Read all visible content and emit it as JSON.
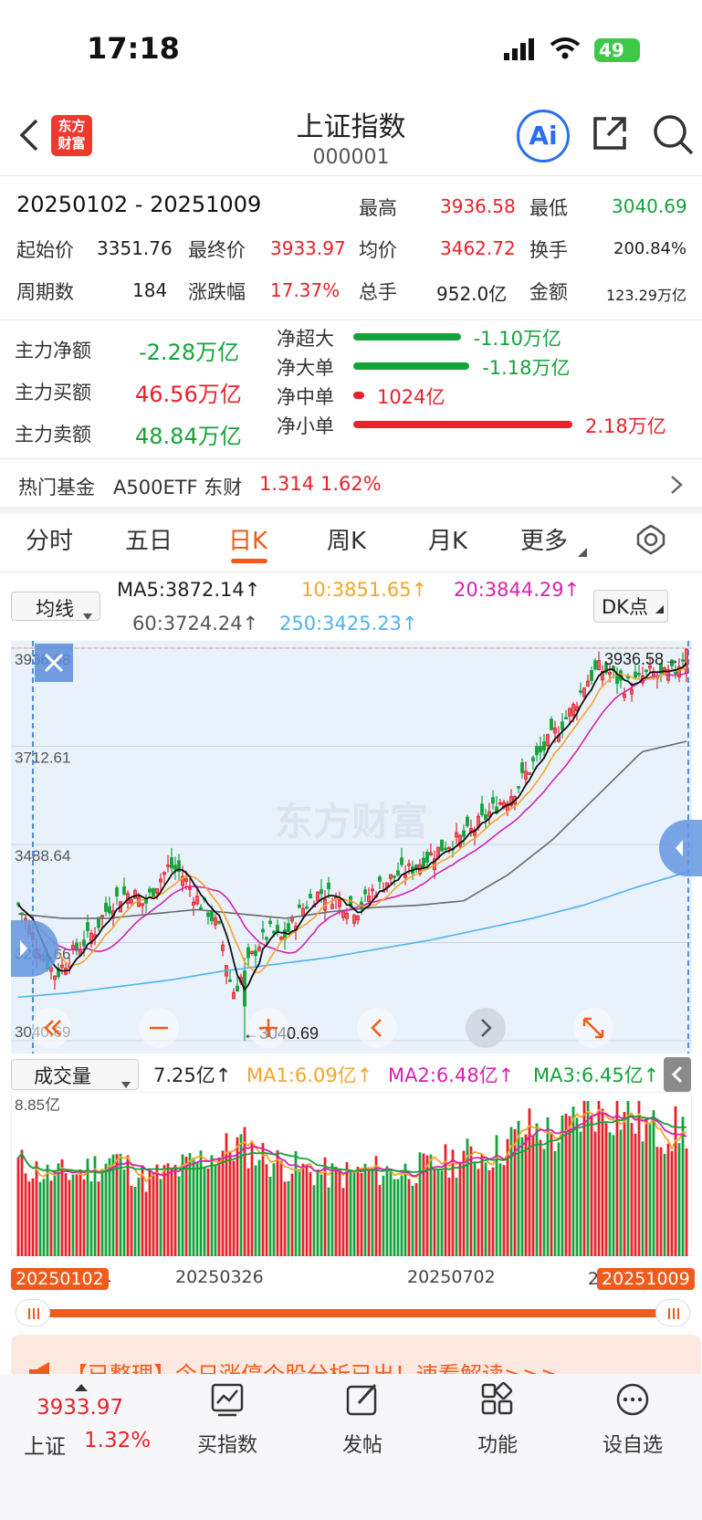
{
  "status_bar": {
    "time": "17:18",
    "battery": "49"
  },
  "header": {
    "title": "上证指数",
    "code": "000001",
    "logo_text_line1": "东方",
    "logo_text_line2": "财富",
    "ai_label": "Ai"
  },
  "summary": {
    "date_range": "20250102 - 20251009",
    "high_label": "最高",
    "high": "3936.58",
    "low_label": "最低",
    "low": "3040.69",
    "open_label": "起始价",
    "open": "3351.76",
    "close_label": "最终价",
    "close": "3933.97",
    "avg_label": "均价",
    "avg": "3462.72",
    "turnover_label": "换手",
    "turnover": "200.84%",
    "periods_label": "周期数",
    "periods": "184",
    "change_label": "涨跌幅",
    "change": "17.37%",
    "volume_label": "总手",
    "volume": "952.0亿",
    "amount_label": "金额",
    "amount": "123.29万亿"
  },
  "capital_flow": {
    "net_label": "主力净额",
    "net": "-2.28万亿",
    "buy_label": "主力买额",
    "buy": "46.56万亿",
    "sell_label": "主力卖额",
    "sell": "48.84万亿",
    "rows": [
      {
        "label": "净超大",
        "value": "-1.10万亿",
        "color": "#14a33a",
        "level": 0.49
      },
      {
        "label": "净大单",
        "value": "-1.18万亿",
        "color": "#14a33a",
        "level": 0.53
      },
      {
        "label": "净中单",
        "value": "1024亿",
        "color": "#e8212a",
        "level": 0.05
      },
      {
        "label": "净小单",
        "value": "2.18万亿",
        "color": "#e8212a",
        "level": 1.0
      }
    ]
  },
  "hot_fund": {
    "label": "热门基金",
    "name": "A500ETF 东财",
    "price": "1.314",
    "pct": "1.62%"
  },
  "tabs": [
    "分时",
    "五日",
    "日K",
    "周K",
    "月K",
    "更多"
  ],
  "active_tab": "日K",
  "ma_bar": {
    "select": "均线",
    "ma5": "MA5:3872.14↑",
    "ma10": "10:3851.65↑",
    "ma20": "20:3844.29↑",
    "ma60": "60:3724.24↑",
    "ma250": "250:3425.23↑",
    "dk": "DK点"
  },
  "price_axis": [
    "3936.58",
    "3712.61",
    "3488.64",
    "3264.66",
    "3040.69"
  ],
  "chart_high_label": "3936.58→",
  "chart_low_label": "←3040.69",
  "watermark": "东方财富",
  "volume_bar": {
    "select": "成交量",
    "vol": "7.25亿↑",
    "ma1": "MA1:6.09亿↑",
    "ma2": "MA2:6.48亿↑",
    "ma3": "MA3:6.45亿↑",
    "axis_max": "8.85亿"
  },
  "date_axis": [
    "20250102",
    "4",
    "20250326",
    "20250702",
    "2",
    "20251009"
  ],
  "banner": {
    "text": "【已整理】今日涨停个股分析已出！速看解读>>>"
  },
  "bottom_nav": {
    "index_price": "3933.97",
    "index_name": "上证",
    "index_pct": "1.32%",
    "items": [
      "买指数",
      "发帖",
      "功能",
      "设自选"
    ]
  },
  "chart_data": {
    "type": "candlestick",
    "x_range": [
      "20250102",
      "20251009"
    ],
    "ylim": [
      3040.69,
      3936.58
    ],
    "yticks": [
      3936.58,
      3712.61,
      3488.64,
      3264.66,
      3040.69
    ],
    "x_tick_labels": [
      "20250102",
      "20250326",
      "20250702",
      "20251009"
    ],
    "close_trend": [
      3352,
      3290,
      3230,
      3190,
      3230,
      3260,
      3290,
      3340,
      3370,
      3380,
      3350,
      3400,
      3440,
      3420,
      3370,
      3340,
      3290,
      3150,
      3200,
      3260,
      3290,
      3270,
      3320,
      3360,
      3380,
      3370,
      3350,
      3340,
      3380,
      3400,
      3420,
      3430,
      3450,
      3470,
      3490,
      3500,
      3520,
      3550,
      3580,
      3600,
      3640,
      3680,
      3720,
      3760,
      3800,
      3860,
      3890,
      3880,
      3850,
      3860,
      3880,
      3870,
      3880,
      3934
    ],
    "ma250_trend": [
      3140,
      3150,
      3165,
      3180,
      3200,
      3215,
      3230,
      3250,
      3270,
      3295,
      3320,
      3350,
      3390,
      3425
    ],
    "ma60_trend": [
      3330,
      3320,
      3320,
      3330,
      3340,
      3330,
      3320,
      3335,
      3345,
      3350,
      3360,
      3420,
      3500,
      3600,
      3700,
      3724
    ],
    "volume_max": 8.85,
    "volume_trend": [
      5.3,
      4.6,
      4.8,
      5.6,
      4.4,
      4.9,
      5.7,
      6.4,
      5.4,
      4.9,
      4.6,
      4.9,
      4.8,
      5.1,
      5.7,
      5.9,
      7.3,
      6.8,
      8.6,
      8.2,
      7.1,
      7.25
    ]
  }
}
